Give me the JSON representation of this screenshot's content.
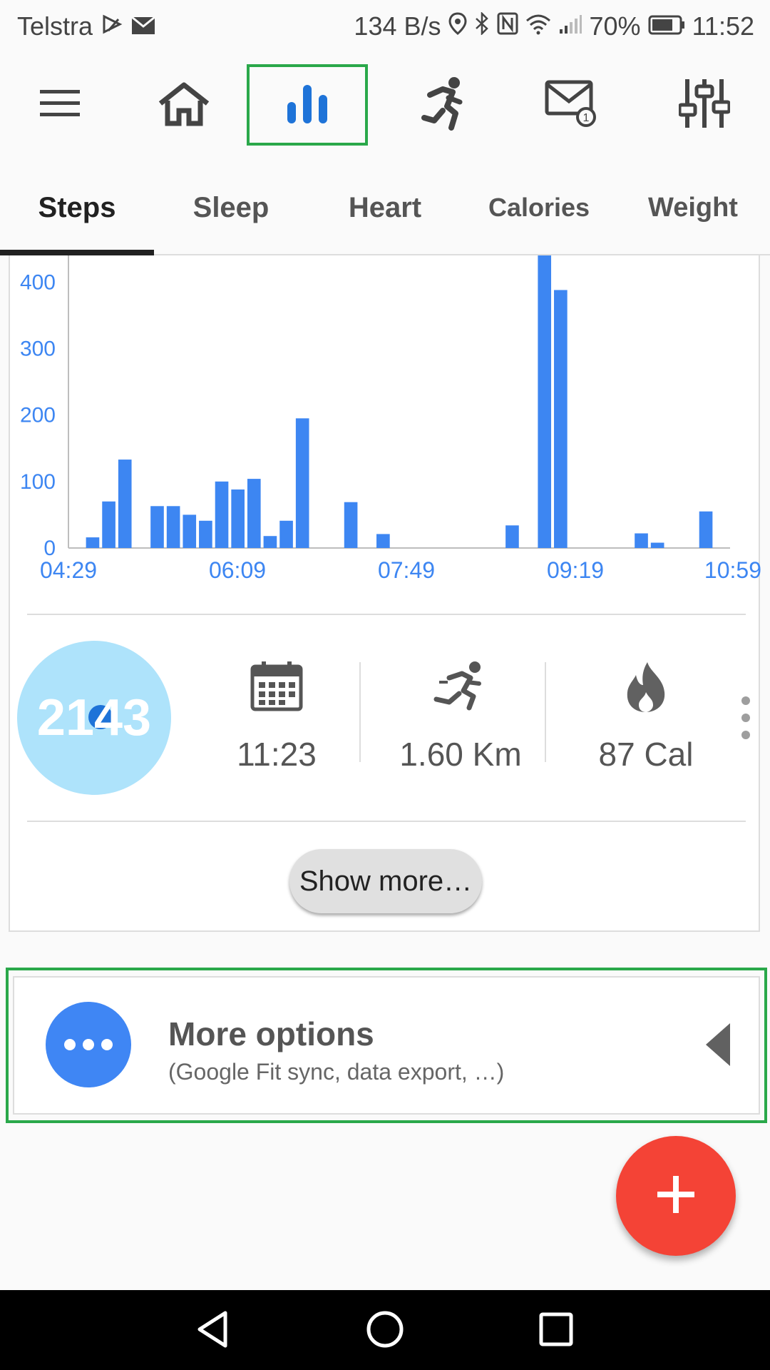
{
  "status_bar": {
    "carrier": "Telstra",
    "network_speed": "134 B/s",
    "battery": "70%",
    "time": "11:52"
  },
  "toolbar": {
    "items": [
      {
        "icon": "menu-icon"
      },
      {
        "icon": "home-icon"
      },
      {
        "icon": "bar-chart-icon",
        "selected": true
      },
      {
        "icon": "running-icon"
      },
      {
        "icon": "mail-settings-icon"
      },
      {
        "icon": "sliders-icon"
      }
    ]
  },
  "tabs": [
    {
      "label": "Steps",
      "active": true
    },
    {
      "label": "Sleep"
    },
    {
      "label": "Heart"
    },
    {
      "label": "Calories"
    },
    {
      "label": "Weight"
    }
  ],
  "chart_data": {
    "type": "bar",
    "title": "",
    "xlabel": "",
    "ylabel": "",
    "ylim": [
      0,
      440
    ],
    "yticks": [
      0,
      100,
      200,
      300,
      400
    ],
    "xticks": [
      "04:29",
      "06:09",
      "07:49",
      "09:19",
      "10:59"
    ],
    "bar_color": "#3d86f2",
    "values": [
      0,
      16,
      70,
      133,
      0,
      63,
      63,
      50,
      41,
      100,
      88,
      104,
      18,
      41,
      195,
      0,
      0,
      69,
      0,
      21,
      0,
      0,
      0,
      0,
      0,
      0,
      0,
      34,
      0,
      441,
      388,
      0,
      0,
      0,
      0,
      22,
      8,
      0,
      0,
      55,
      0
    ]
  },
  "stats": {
    "steps": "2143",
    "time": "11:23",
    "distance": "1.60 Km",
    "calories": "87 Cal",
    "goal_progress": 0.05
  },
  "show_more_label": "Show more…",
  "more_options": {
    "title": "More options",
    "subtitle": "(Google Fit sync, data export, …)"
  },
  "colors": {
    "accent_blue": "#3d86f2",
    "fab_red": "#f44336",
    "highlight_green": "#2aa84a"
  }
}
